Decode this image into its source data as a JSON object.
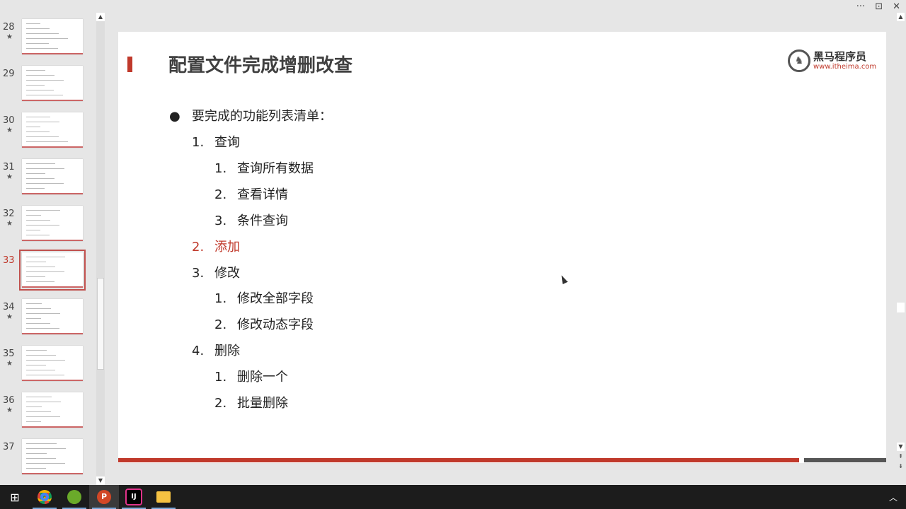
{
  "window": {
    "more_label": "···",
    "present_label": "⊡",
    "close_label": "✕"
  },
  "thumbnails": [
    {
      "number": "28",
      "star": "★"
    },
    {
      "number": "29",
      "star": ""
    },
    {
      "number": "30",
      "star": "★"
    },
    {
      "number": "31",
      "star": "★"
    },
    {
      "number": "32",
      "star": "★"
    },
    {
      "number": "33",
      "star": "",
      "selected": true
    },
    {
      "number": "34",
      "star": "★"
    },
    {
      "number": "35",
      "star": "★"
    },
    {
      "number": "36",
      "star": "★"
    },
    {
      "number": "37",
      "star": ""
    }
  ],
  "slide": {
    "title": "配置文件完成增删改查",
    "logo": {
      "name": "黑马程序员",
      "url": "www.itheima.com"
    },
    "bullet": "要完成的功能列表清单：",
    "items": [
      {
        "num": "1.",
        "text": "查询",
        "level": 1
      },
      {
        "num": "1.",
        "text": "查询所有数据",
        "level": 2
      },
      {
        "num": "2.",
        "text": "查看详情",
        "level": 2
      },
      {
        "num": "3.",
        "text": "条件查询",
        "level": 2
      },
      {
        "num": "2.",
        "text": "添加",
        "level": 1,
        "highlight": true
      },
      {
        "num": "3.",
        "text": "修改",
        "level": 1
      },
      {
        "num": "1.",
        "text": "修改全部字段",
        "level": 2
      },
      {
        "num": "2.",
        "text": "修改动态字段",
        "level": 2
      },
      {
        "num": "4.",
        "text": "删除",
        "level": 1
      },
      {
        "num": "1.",
        "text": "删除一个",
        "level": 2
      },
      {
        "num": "2.",
        "text": "批量删除",
        "level": 2
      }
    ]
  },
  "colors": {
    "accent": "#c0392b",
    "text": "#404040"
  },
  "taskbar": [
    "windows-start",
    "chrome",
    "app-green",
    "powerpoint",
    "intellij",
    "file-explorer"
  ]
}
